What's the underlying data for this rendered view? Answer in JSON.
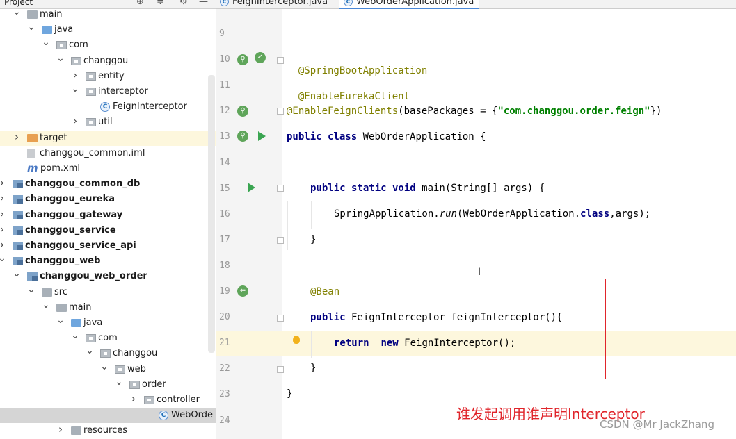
{
  "project_panel": {
    "title": "Project",
    "tree": [
      {
        "label": "main",
        "depth": 1,
        "arrow": "down",
        "icon": "folder"
      },
      {
        "label": "java",
        "depth": 2,
        "arrow": "down",
        "icon": "folder-blue"
      },
      {
        "label": "com",
        "depth": 3,
        "arrow": "down",
        "icon": "package"
      },
      {
        "label": "changgou",
        "depth": 4,
        "arrow": "down",
        "icon": "package"
      },
      {
        "label": "entity",
        "depth": 5,
        "arrow": "right",
        "icon": "package"
      },
      {
        "label": "interceptor",
        "depth": 5,
        "arrow": "down",
        "icon": "package"
      },
      {
        "label": "FeignInterceptor",
        "depth": 6,
        "arrow": "",
        "icon": "class"
      },
      {
        "label": "util",
        "depth": 5,
        "arrow": "right",
        "icon": "package"
      },
      {
        "label": "target",
        "depth": 1,
        "arrow": "right",
        "icon": "folder-orange",
        "highlight": true
      },
      {
        "label": "changgou_common.iml",
        "depth": 1,
        "arrow": "",
        "icon": "iml"
      },
      {
        "label": "pom.xml",
        "depth": 1,
        "arrow": "",
        "icon": "maven"
      },
      {
        "label": "changgou_common_db",
        "depth": 0,
        "arrow": "right",
        "icon": "module",
        "bold": true
      },
      {
        "label": "changgou_eureka",
        "depth": 0,
        "arrow": "right",
        "icon": "module",
        "bold": true
      },
      {
        "label": "changgou_gateway",
        "depth": 0,
        "arrow": "right",
        "icon": "module",
        "bold": true
      },
      {
        "label": "changgou_service",
        "depth": 0,
        "arrow": "right",
        "icon": "module",
        "bold": true
      },
      {
        "label": "changgou_service_api",
        "depth": 0,
        "arrow": "right",
        "icon": "module",
        "bold": true
      },
      {
        "label": "changgou_web",
        "depth": 0,
        "arrow": "down",
        "icon": "module",
        "bold": true
      },
      {
        "label": "changgou_web_order",
        "depth": 1,
        "arrow": "down",
        "icon": "module",
        "bold": true
      },
      {
        "label": "src",
        "depth": 2,
        "arrow": "down",
        "icon": "folder"
      },
      {
        "label": "main",
        "depth": 3,
        "arrow": "down",
        "icon": "folder"
      },
      {
        "label": "java",
        "depth": 4,
        "arrow": "down",
        "icon": "folder-blue"
      },
      {
        "label": "com",
        "depth": 5,
        "arrow": "down",
        "icon": "package"
      },
      {
        "label": "changgou",
        "depth": 6,
        "arrow": "down",
        "icon": "package"
      },
      {
        "label": "web",
        "depth": 7,
        "arrow": "down",
        "icon": "package"
      },
      {
        "label": "order",
        "depth": 8,
        "arrow": "down",
        "icon": "package"
      },
      {
        "label": "controller",
        "depth": 9,
        "arrow": "right",
        "icon": "package"
      },
      {
        "label": "WebOrde",
        "depth": 10,
        "arrow": "",
        "icon": "class",
        "selected": true
      },
      {
        "label": "resources",
        "depth": 4,
        "arrow": "right",
        "icon": "folder"
      }
    ]
  },
  "tabs": [
    {
      "label": "FeignInterceptor.java",
      "active": false
    },
    {
      "label": "WebOrderApplication.java",
      "active": true
    }
  ],
  "editor": {
    "lines": [
      {
        "num": "9"
      },
      {
        "num": "10"
      },
      {
        "num": "11"
      },
      {
        "num": "12"
      },
      {
        "num": "13"
      },
      {
        "num": "14"
      },
      {
        "num": "15"
      },
      {
        "num": "16"
      },
      {
        "num": "17"
      },
      {
        "num": "18"
      },
      {
        "num": "19"
      },
      {
        "num": "20"
      },
      {
        "num": "21"
      },
      {
        "num": "22"
      },
      {
        "num": "23"
      },
      {
        "num": "24"
      }
    ],
    "code": {
      "l10": "@SpringBootApplication",
      "l11": "@EnableEurekaClient",
      "l12_ann": "@EnableFeignClients",
      "l12_mid": "(basePackages = {",
      "l12_str": "\"com.changgou.order.feign\"",
      "l12_end": "})",
      "l13_kw": "public class",
      "l13_rest": " WebOrderApplication {",
      "l15_kw": "public static void",
      "l15_rest": " main(String[] args) {",
      "l16_a": "SpringApplication.",
      "l16_it": "run",
      "l16_b": "(WebOrderApplication.",
      "l16_kw": "class",
      "l16_c": ",args);",
      "l17": "}",
      "l19": "@Bean",
      "l20_kw": "public",
      "l20_rest": " FeignInterceptor feignInterceptor(){",
      "l21_kw1": "return",
      "l21_kw2": "new",
      "l21_rest": " FeignInterceptor();",
      "l22": "}",
      "l23": "}"
    }
  },
  "annotation_note": "谁发起调用谁声明Interceptor",
  "watermark": "CSDN @Mr JackZhang"
}
